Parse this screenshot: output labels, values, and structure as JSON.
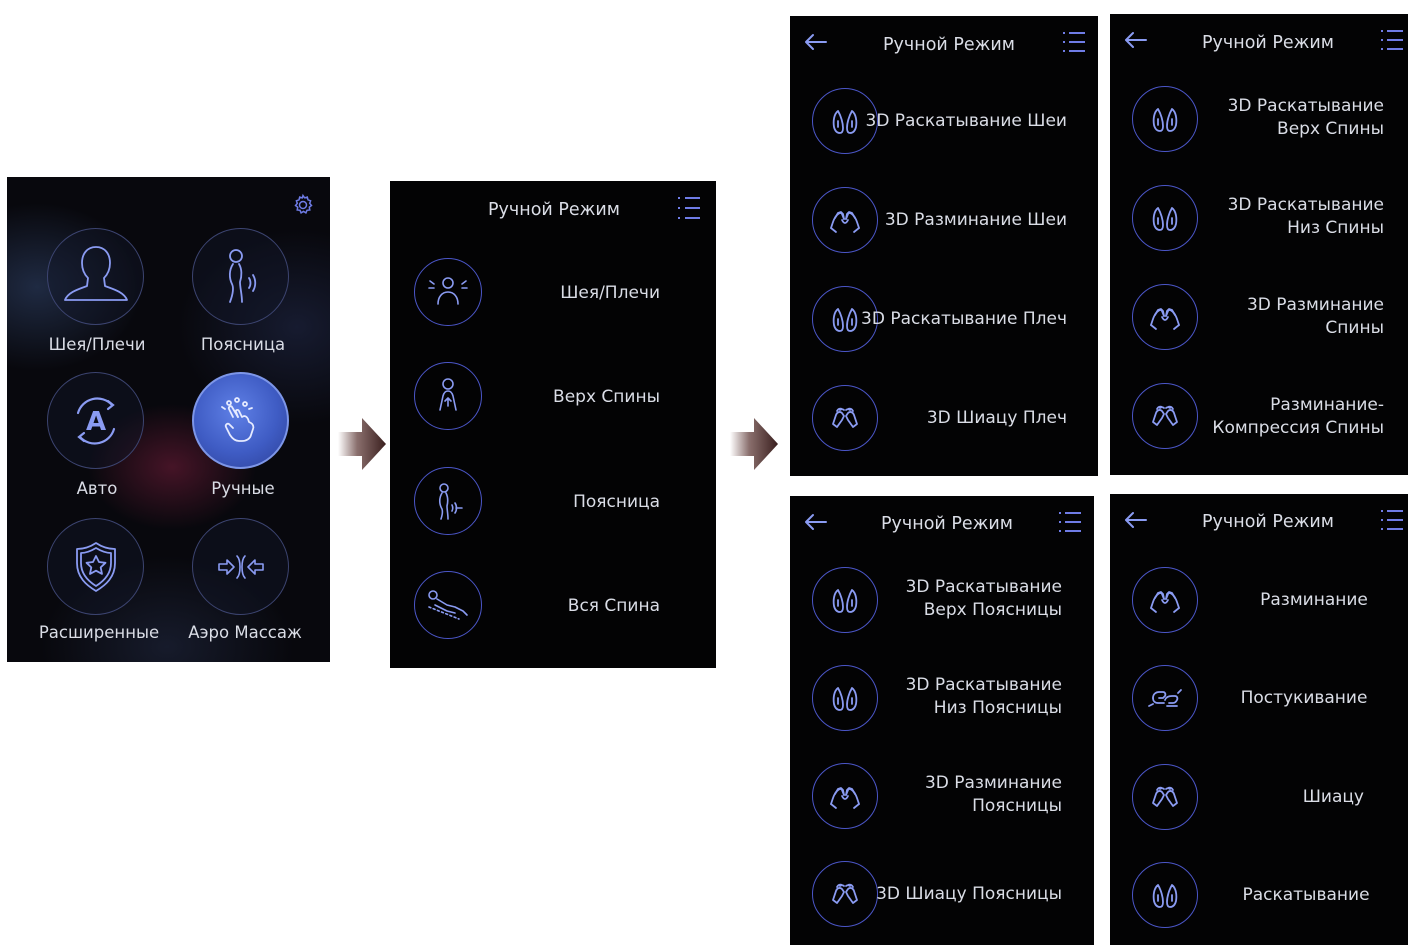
{
  "screen1": {
    "settings_icon": "gear-icon",
    "tiles": [
      {
        "label": "Шея/Плечи",
        "icon": "head-shoulders-icon"
      },
      {
        "label": "Поясница",
        "icon": "lower-back-icon"
      },
      {
        "label": "Авто",
        "icon": "auto-icon"
      },
      {
        "label": "Ручные",
        "icon": "manual-touch-icon"
      },
      {
        "label": "Расширенные",
        "icon": "shield-star-icon"
      },
      {
        "label": "Аэро Массаж",
        "icon": "air-compress-icon"
      }
    ]
  },
  "screen2": {
    "title": "Ручной Режим",
    "items": [
      {
        "label": "Шея/Плечи",
        "icon": "neck-shoulders-icon"
      },
      {
        "label": "Верх Спины",
        "icon": "upper-back-icon"
      },
      {
        "label": "Поясница",
        "icon": "lower-back-icon"
      },
      {
        "label": "Вся Спина",
        "icon": "full-back-icon"
      }
    ]
  },
  "screen3": {
    "title": "Ручной Режим",
    "items": [
      {
        "label": "3D Раскатывание Шеи",
        "icon": "rolling-icon"
      },
      {
        "label": "3D Разминание Шеи",
        "icon": "kneading-icon"
      },
      {
        "label": "3D Раскатывание Плеч",
        "icon": "rolling-icon"
      },
      {
        "label": "3D Шиацу Плеч",
        "icon": "shiatsu-icon"
      }
    ]
  },
  "screen4": {
    "title": "Ручной Режим",
    "items": [
      {
        "line1": "3D Раскатывание",
        "line2": "Верх Спины",
        "icon": "rolling-icon"
      },
      {
        "line1": "3D Раскатывание",
        "line2": "Низ Спины",
        "icon": "rolling-icon"
      },
      {
        "line1": "3D Разминание",
        "line2": "Спины",
        "icon": "kneading-icon"
      },
      {
        "line1": "Разминание-",
        "line2": "Компрессия Спины",
        "icon": "shiatsu-icon"
      }
    ]
  },
  "screen5": {
    "title": "Ручной Режим",
    "items": [
      {
        "line1": "3D Раскатывание",
        "line2": "Верх Поясницы",
        "icon": "rolling-icon"
      },
      {
        "line1": "3D Раскатывание",
        "line2": "Низ Поясницы",
        "icon": "rolling-icon"
      },
      {
        "line1": "3D Разминание",
        "line2": "Поясницы",
        "icon": "kneading-icon"
      },
      {
        "line1": "3D Шиацу Поясницы",
        "icon": "shiatsu-icon"
      }
    ]
  },
  "screen6": {
    "title": "Ручной Режим",
    "items": [
      {
        "label": "Разминание",
        "icon": "kneading-icon"
      },
      {
        "label": "Постукивание",
        "icon": "tapping-icon"
      },
      {
        "label": "Шиацу",
        "icon": "shiatsu-icon"
      },
      {
        "label": "Раскатывание",
        "icon": "rolling-icon"
      }
    ]
  },
  "colors": {
    "accent": "#4b56c8",
    "background": "#030304",
    "text": "#dadde6",
    "arrow": "#3a1f1e"
  }
}
